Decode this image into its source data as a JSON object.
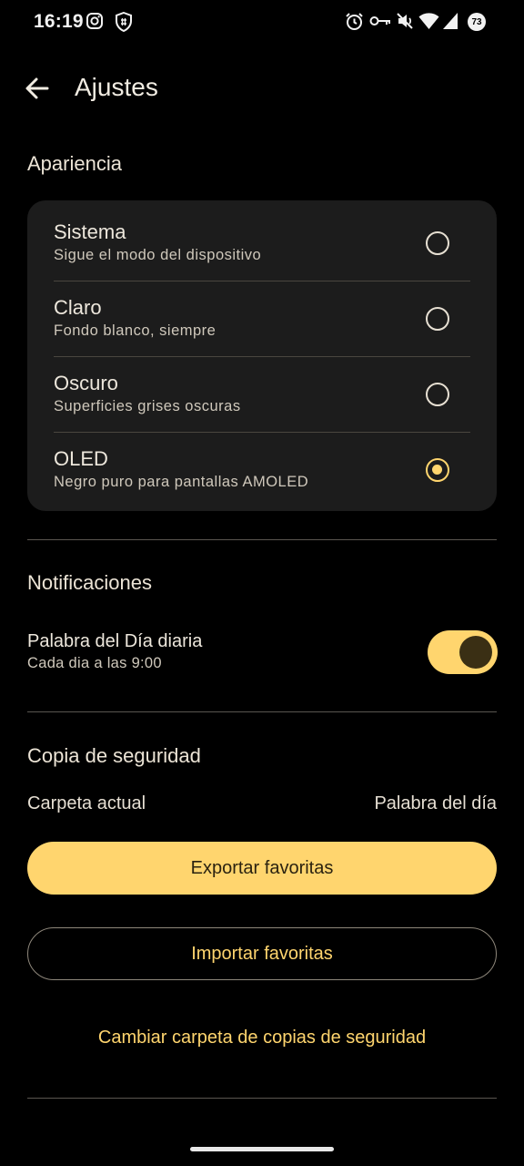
{
  "status_bar": {
    "time": "16:19",
    "battery_level": "73",
    "icons": [
      "instagram-icon",
      "vpn-shield-icon",
      "alarm-icon",
      "key-icon",
      "mute-icon",
      "wifi-icon",
      "signal-icon",
      "battery-icon"
    ]
  },
  "app_bar": {
    "back_icon": "arrow-back-icon",
    "title": "Ajustes"
  },
  "appearance": {
    "section_title": "Apariencia",
    "options": [
      {
        "label": "Sistema",
        "subtitle": "Sigue el modo del dispositivo",
        "selected": false
      },
      {
        "label": "Claro",
        "subtitle": "Fondo blanco, siempre",
        "selected": false
      },
      {
        "label": "Oscuro",
        "subtitle": "Superficies grises oscuras",
        "selected": false
      },
      {
        "label": "OLED",
        "subtitle": "Negro puro para pantallas AMOLED",
        "selected": true
      }
    ]
  },
  "notifications": {
    "section_title": "Notificaciones",
    "daily_word_label": "Palabra del Día diaria",
    "daily_word_subtitle": "Cada dia a las 9:00",
    "daily_word_enabled": true
  },
  "backup": {
    "section_title": "Copia de seguridad",
    "current_folder_label": "Carpeta actual",
    "current_folder_value": "Palabra del día",
    "export_label": "Exportar favoritas",
    "import_label": "Importar favoritas",
    "change_folder_label": "Cambiar carpeta de copias de seguridad"
  },
  "colors": {
    "background": "#000000",
    "accent": "#ffd56e",
    "card": "#1c1c1c",
    "text": "#ece6da"
  }
}
